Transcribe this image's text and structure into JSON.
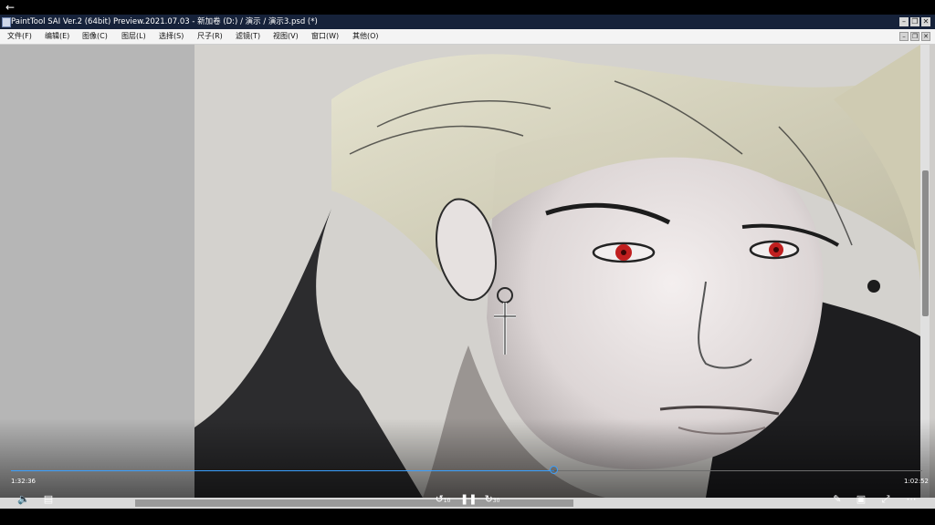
{
  "window": {
    "back_icon": "back-arrow-icon",
    "title": "PaintTool SAI Ver.2 (64bit) Preview.2021.07.03 - 新加卷 (D:) / 演示 / 演示3.psd (*)",
    "title_bg": "#16223a"
  },
  "menu": {
    "items": [
      "文件(F)",
      "编辑(E)",
      "图像(C)",
      "图层(L)",
      "选择(S)",
      "尺子(R)",
      "滤镜(T)",
      "视图(V)",
      "窗口(W)",
      "其他(O)"
    ]
  },
  "player": {
    "elapsed": "1:32:36",
    "duration": "1:02:52",
    "progress": 0.596,
    "accent": "#3aa0ff",
    "rewind_seconds": "10",
    "forward_seconds": "30"
  }
}
